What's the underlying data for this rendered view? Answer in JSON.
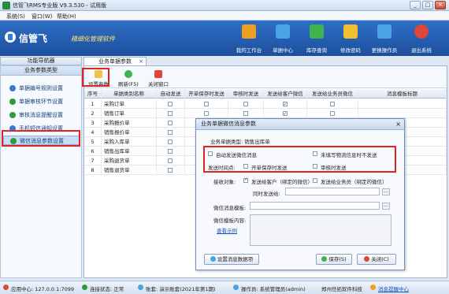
{
  "window": {
    "title": "信管飞RMS专业版 V9.3.530 - 试用版",
    "buttons": [
      "_",
      "□",
      "×"
    ]
  },
  "menu": [
    "系统(S)",
    "窗口(W)",
    "帮助(H)"
  ],
  "banner": {
    "logo": "信管飞",
    "tagline": "精细化管理软件",
    "tools": [
      {
        "label": "我的工作台",
        "color": "#f0a020"
      },
      {
        "label": "单据中心",
        "color": "#4ba3e3"
      },
      {
        "label": "库存查询",
        "color": "#3fb34f"
      },
      {
        "label": "修改密码",
        "color": "#f0c030"
      },
      {
        "label": "更换操作员",
        "color": "#4ba3e3"
      },
      {
        "label": "退出系统",
        "color": "#e0443a"
      }
    ]
  },
  "left": {
    "tab": "功能导航器",
    "header": "业务参数类型",
    "items": [
      {
        "label": "单据编号规则设置",
        "color": "#3a78d0"
      },
      {
        "label": "单据审核环节设置",
        "color": "#2e9a3c"
      },
      {
        "label": "审核消息提醒设置",
        "color": "#2e9a3c"
      },
      {
        "label": "手机短信通知设置",
        "color": "#3a78d0"
      },
      {
        "label": "微信消息参数设置",
        "color": "#2e9a3c"
      }
    ]
  },
  "tabs": [
    {
      "label": "业务单据参数",
      "close": "×"
    }
  ],
  "toolbar": {
    "setup": "设置参数",
    "refresh": "刷新(F5)",
    "close": "关闭窗口"
  },
  "table": {
    "headers": [
      "序号",
      "单据类别名称",
      "自动发送",
      "开单保存时发送",
      "审核时发送",
      "发送给客户微信",
      "发送给业务员微信",
      "消息模板标题"
    ],
    "rows": [
      {
        "no": "1",
        "name": "采购订单",
        "checks": [
          false,
          false,
          false,
          true,
          false
        ]
      },
      {
        "no": "2",
        "name": "销售订单",
        "checks": [
          false,
          false,
          false,
          true,
          false
        ]
      },
      {
        "no": "3",
        "name": "采购报价单",
        "checks": [
          false,
          false,
          false,
          true,
          false
        ]
      },
      {
        "no": "4",
        "name": "销售报价单",
        "checks": [
          false,
          false,
          false,
          true,
          false
        ]
      },
      {
        "no": "5",
        "name": "采购入库单",
        "checks": [
          false,
          false,
          false,
          true,
          false
        ]
      },
      {
        "no": "6",
        "name": "销售出库单",
        "checks": [
          false,
          false,
          false,
          true,
          false
        ]
      },
      {
        "no": "7",
        "name": "采购退货单",
        "checks": [
          false,
          false,
          false,
          true,
          false
        ]
      },
      {
        "no": "8",
        "name": "销售退货单",
        "checks": [
          false,
          false,
          false,
          true,
          false
        ]
      }
    ]
  },
  "dialog": {
    "title": "业务单据微信消息参数",
    "close": "×",
    "doc_type": "业务单据类型: 销售出库单",
    "opt_auto": "自动发送微信消息",
    "opt_unpaid": "未填写物流信息时不发送",
    "send_point": "发送时间点:",
    "opt_save": "开单保存时发送",
    "opt_audit": "审核时发送",
    "receiver_label": "接收对象:",
    "recv_customer": "发送给客户（绑定的微信）",
    "recv_sales": "发送给业务员（绑定的微信）",
    "cc_label": "同时发送给:",
    "template_label": "微信消息模板:",
    "content_label": "微信模板内容:",
    "example_link": "查看示例",
    "btn_setup": "设置消息数据项",
    "btn_save": "保存(S)",
    "btn_close": "关闭(C)"
  },
  "status": {
    "app_center": "应用中心: 127.0.0.1:7099",
    "connect": "连接状态: 正常",
    "account": "账套: 演示账套(2021年第1期)",
    "operator": "操作员: 系统管理员(admin)",
    "company": "郑州任拓软件科技 ",
    "msg": "消息提醒中心"
  }
}
